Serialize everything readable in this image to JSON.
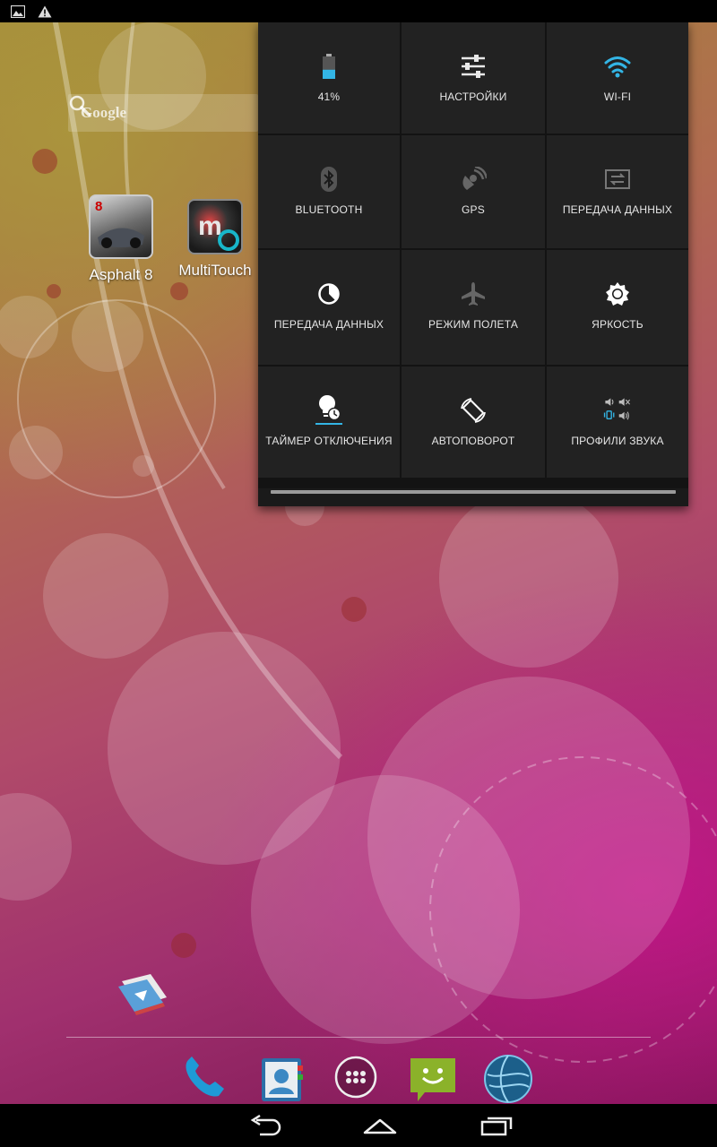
{
  "status_bar": {
    "icons": [
      "image-notification-icon",
      "warning-icon"
    ]
  },
  "search": {
    "placeholder": "Google"
  },
  "home_apps": [
    {
      "label": "Asphalt 8",
      "icon": "asphalt-8-icon"
    },
    {
      "label": "MultiTouch",
      "icon": "multitouch-icon"
    }
  ],
  "quick_settings": {
    "tiles": [
      {
        "label": "41%",
        "icon": "battery-icon"
      },
      {
        "label": "НАСТРОЙКИ",
        "icon": "settings-sliders-icon"
      },
      {
        "label": "WI-FI",
        "icon": "wifi-icon"
      },
      {
        "label": "BLUETOOTH",
        "icon": "bluetooth-icon"
      },
      {
        "label": "GPS",
        "icon": "gps-icon"
      },
      {
        "label": "ПЕРЕДАЧА ДАННЫХ",
        "icon": "data-transfer-icon"
      },
      {
        "label": "ПЕРЕДАЧА ДАННЫХ",
        "icon": "data-usage-icon"
      },
      {
        "label": "РЕЖИМ ПОЛЕТА",
        "icon": "airplane-icon"
      },
      {
        "label": "ЯРКОСТЬ",
        "icon": "brightness-icon"
      },
      {
        "label": "ТАЙМЕР ОТКЛЮЧЕНИЯ",
        "icon": "sleep-timer-icon"
      },
      {
        "label": "АВТОПОВОРОТ",
        "icon": "auto-rotate-icon"
      },
      {
        "label": "ПРОФИЛИ ЗВУКА",
        "icon": "sound-profiles-icon"
      }
    ]
  },
  "battery": {
    "level_percent": 41
  },
  "dock": {
    "icons": [
      "phone-icon",
      "contacts-icon",
      "all-apps-icon",
      "messaging-icon",
      "browser-icon"
    ]
  },
  "nav_bar": {
    "buttons": [
      "back-icon",
      "home-icon",
      "recent-apps-icon"
    ]
  },
  "colors": {
    "accent_blue": "#33b5e5",
    "panel_bg": "#1a1a1a",
    "tile_bg": "#222222"
  }
}
